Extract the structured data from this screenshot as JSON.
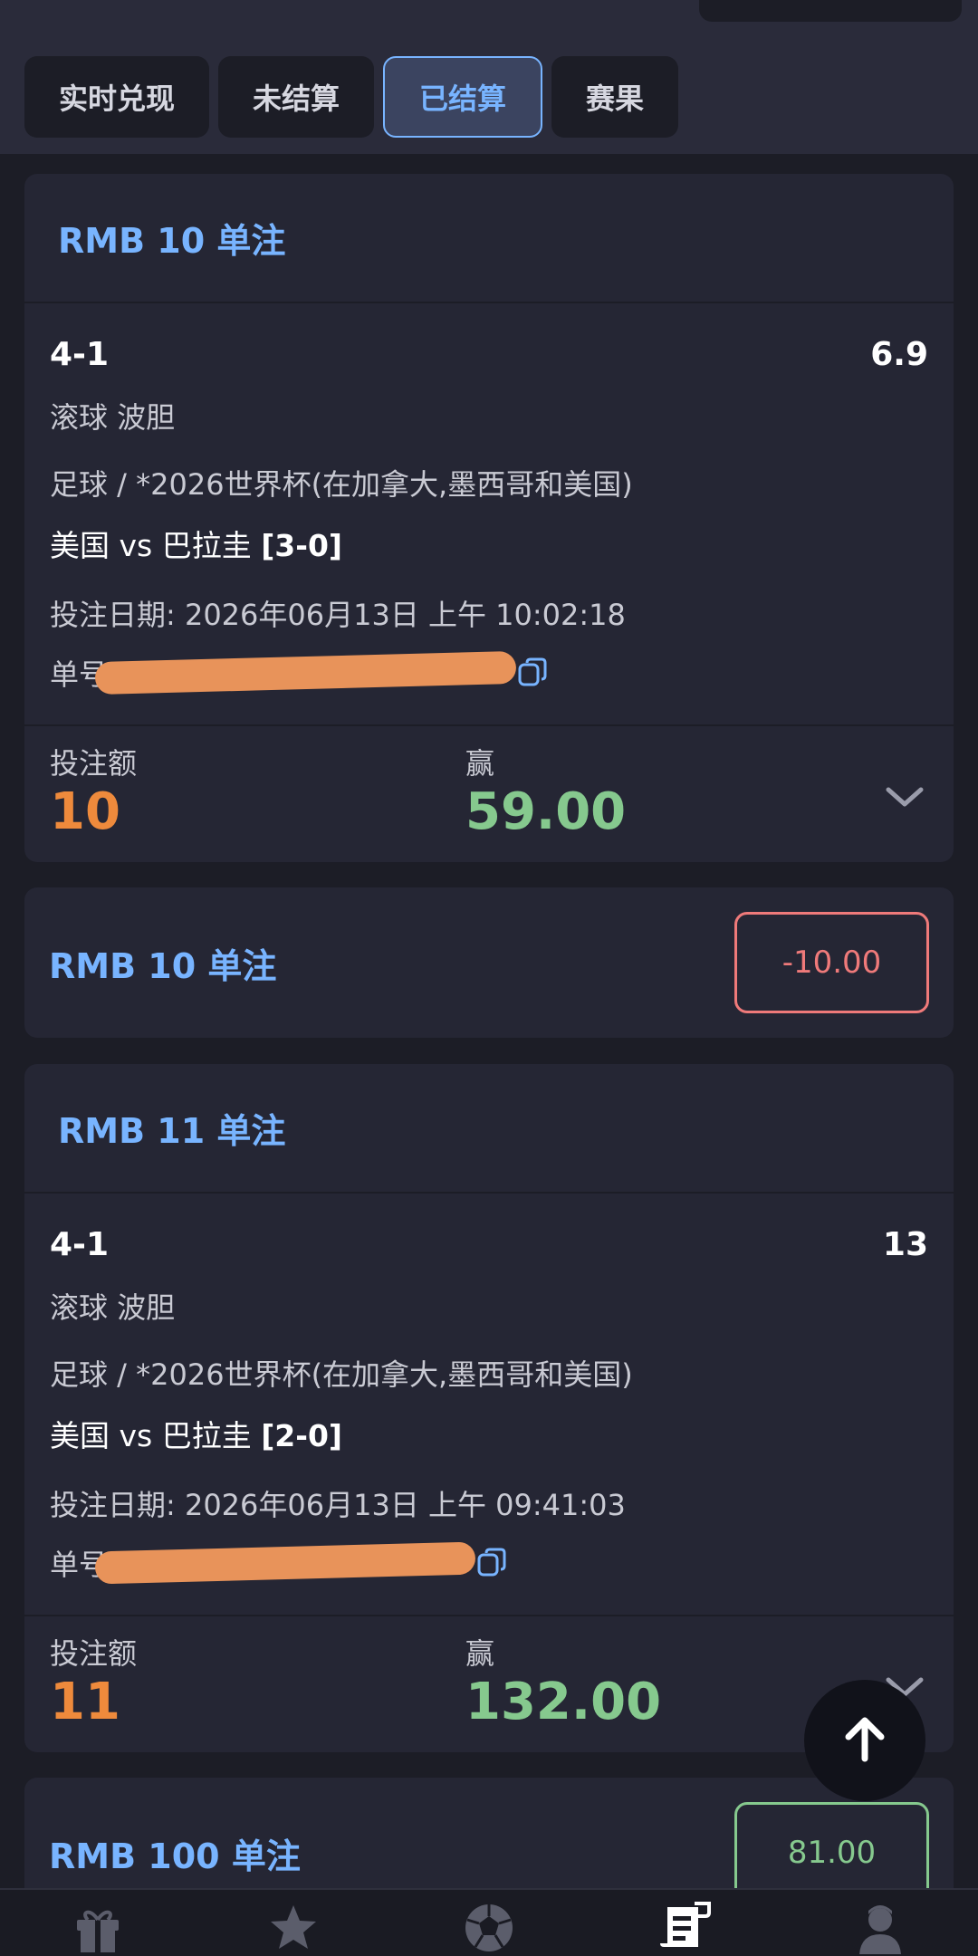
{
  "tabs": [
    {
      "label": "实时兑现",
      "active": false
    },
    {
      "label": "未结算",
      "active": false
    },
    {
      "label": "已结算",
      "active": true
    },
    {
      "label": "赛果",
      "active": false
    }
  ],
  "bets": [
    {
      "title": "RMB 10 单注",
      "selection": "4-1",
      "odds": "6.9",
      "market": "滚球 波胆",
      "league": "足球 / *2026世界杯(在加拿大,墨西哥和美国)",
      "teams": "美国 vs 巴拉圭",
      "score": "[3-0]",
      "bet_date": "投注日期: 2026年06月13日 上午 10:02:18",
      "ticket_label": "单号",
      "stake_label": "投注额",
      "stake": "10",
      "win_label": "赢",
      "win": "59.00"
    },
    {
      "title": "RMB 10 单注",
      "result": "-10.00"
    },
    {
      "title": "RMB 11 单注",
      "selection": "4-1",
      "odds": "13",
      "market": "滚球 波胆",
      "league": "足球 / *2026世界杯(在加拿大,墨西哥和美国)",
      "teams": "美国 vs 巴拉圭",
      "score": "[2-0]",
      "bet_date": "投注日期: 2026年06月13日 上午 09:41:03",
      "ticket_label": "单号",
      "stake_label": "投注额",
      "stake": "11",
      "win_label": "赢",
      "win": "132.00"
    },
    {
      "title": "RMB 100 单注",
      "result": "81.00"
    }
  ],
  "colors": {
    "accent": "#78b4ff",
    "stake": "#ee8a3c",
    "win": "#86c98e",
    "loss": "#ef7a7a",
    "background": "#1c1d26",
    "card": "#252634"
  },
  "icons": [
    "gift-icon",
    "star-icon",
    "soccer-ball-icon",
    "bet-slip-icon",
    "profile-icon",
    "copy-icon",
    "chevron-down-icon",
    "arrow-up-icon"
  ]
}
